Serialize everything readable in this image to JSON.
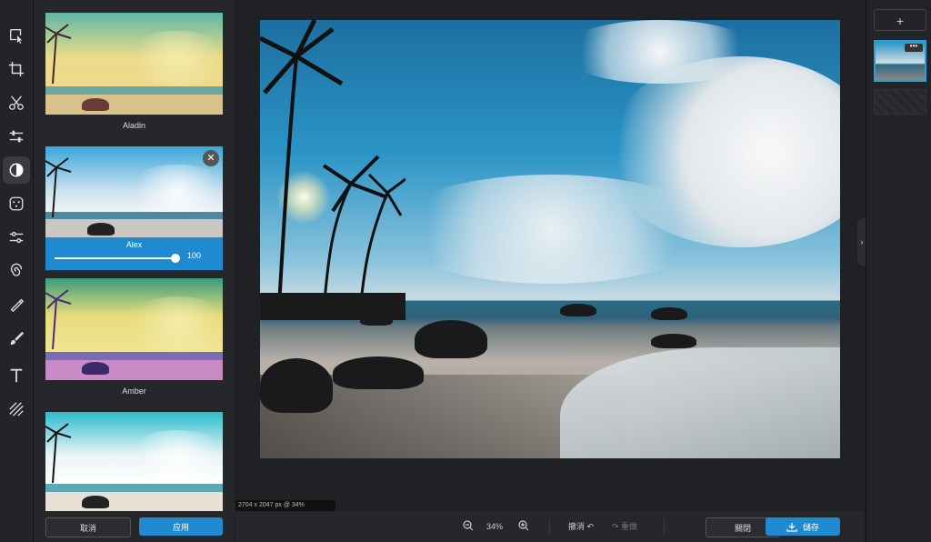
{
  "toolbar": {
    "tools": [
      {
        "name": "select-icon"
      },
      {
        "name": "crop-icon"
      },
      {
        "name": "cut-icon"
      },
      {
        "name": "adjust-icon"
      },
      {
        "name": "filter-icon"
      },
      {
        "name": "effects-icon"
      },
      {
        "name": "curves-icon"
      },
      {
        "name": "spiral-icon"
      },
      {
        "name": "retouch-icon"
      },
      {
        "name": "brush-icon"
      },
      {
        "name": "text-icon"
      },
      {
        "name": "texture-icon"
      }
    ],
    "active": "filter-icon"
  },
  "filters": {
    "items": [
      {
        "label": "Aladin"
      },
      {
        "label": "Alex",
        "selected": true,
        "intensity": "100"
      },
      {
        "label": "Amber"
      },
      {
        "label": ""
      }
    ],
    "cancel_label": "取消",
    "apply_label": "应用"
  },
  "canvas": {
    "dimensions_label": "2704 x 2047 px @ 34%"
  },
  "bottom_bar": {
    "zoom_value": "34%",
    "undo_label": "撤消",
    "redo_label": "重做",
    "close_label": "關閉",
    "save_label": "儲存"
  },
  "layers": {
    "add_label": "+",
    "menu_label": "•••"
  },
  "colors": {
    "accent": "#1f8ad0",
    "panel_bg": "#26272b",
    "canvas_bg": "#202124"
  }
}
